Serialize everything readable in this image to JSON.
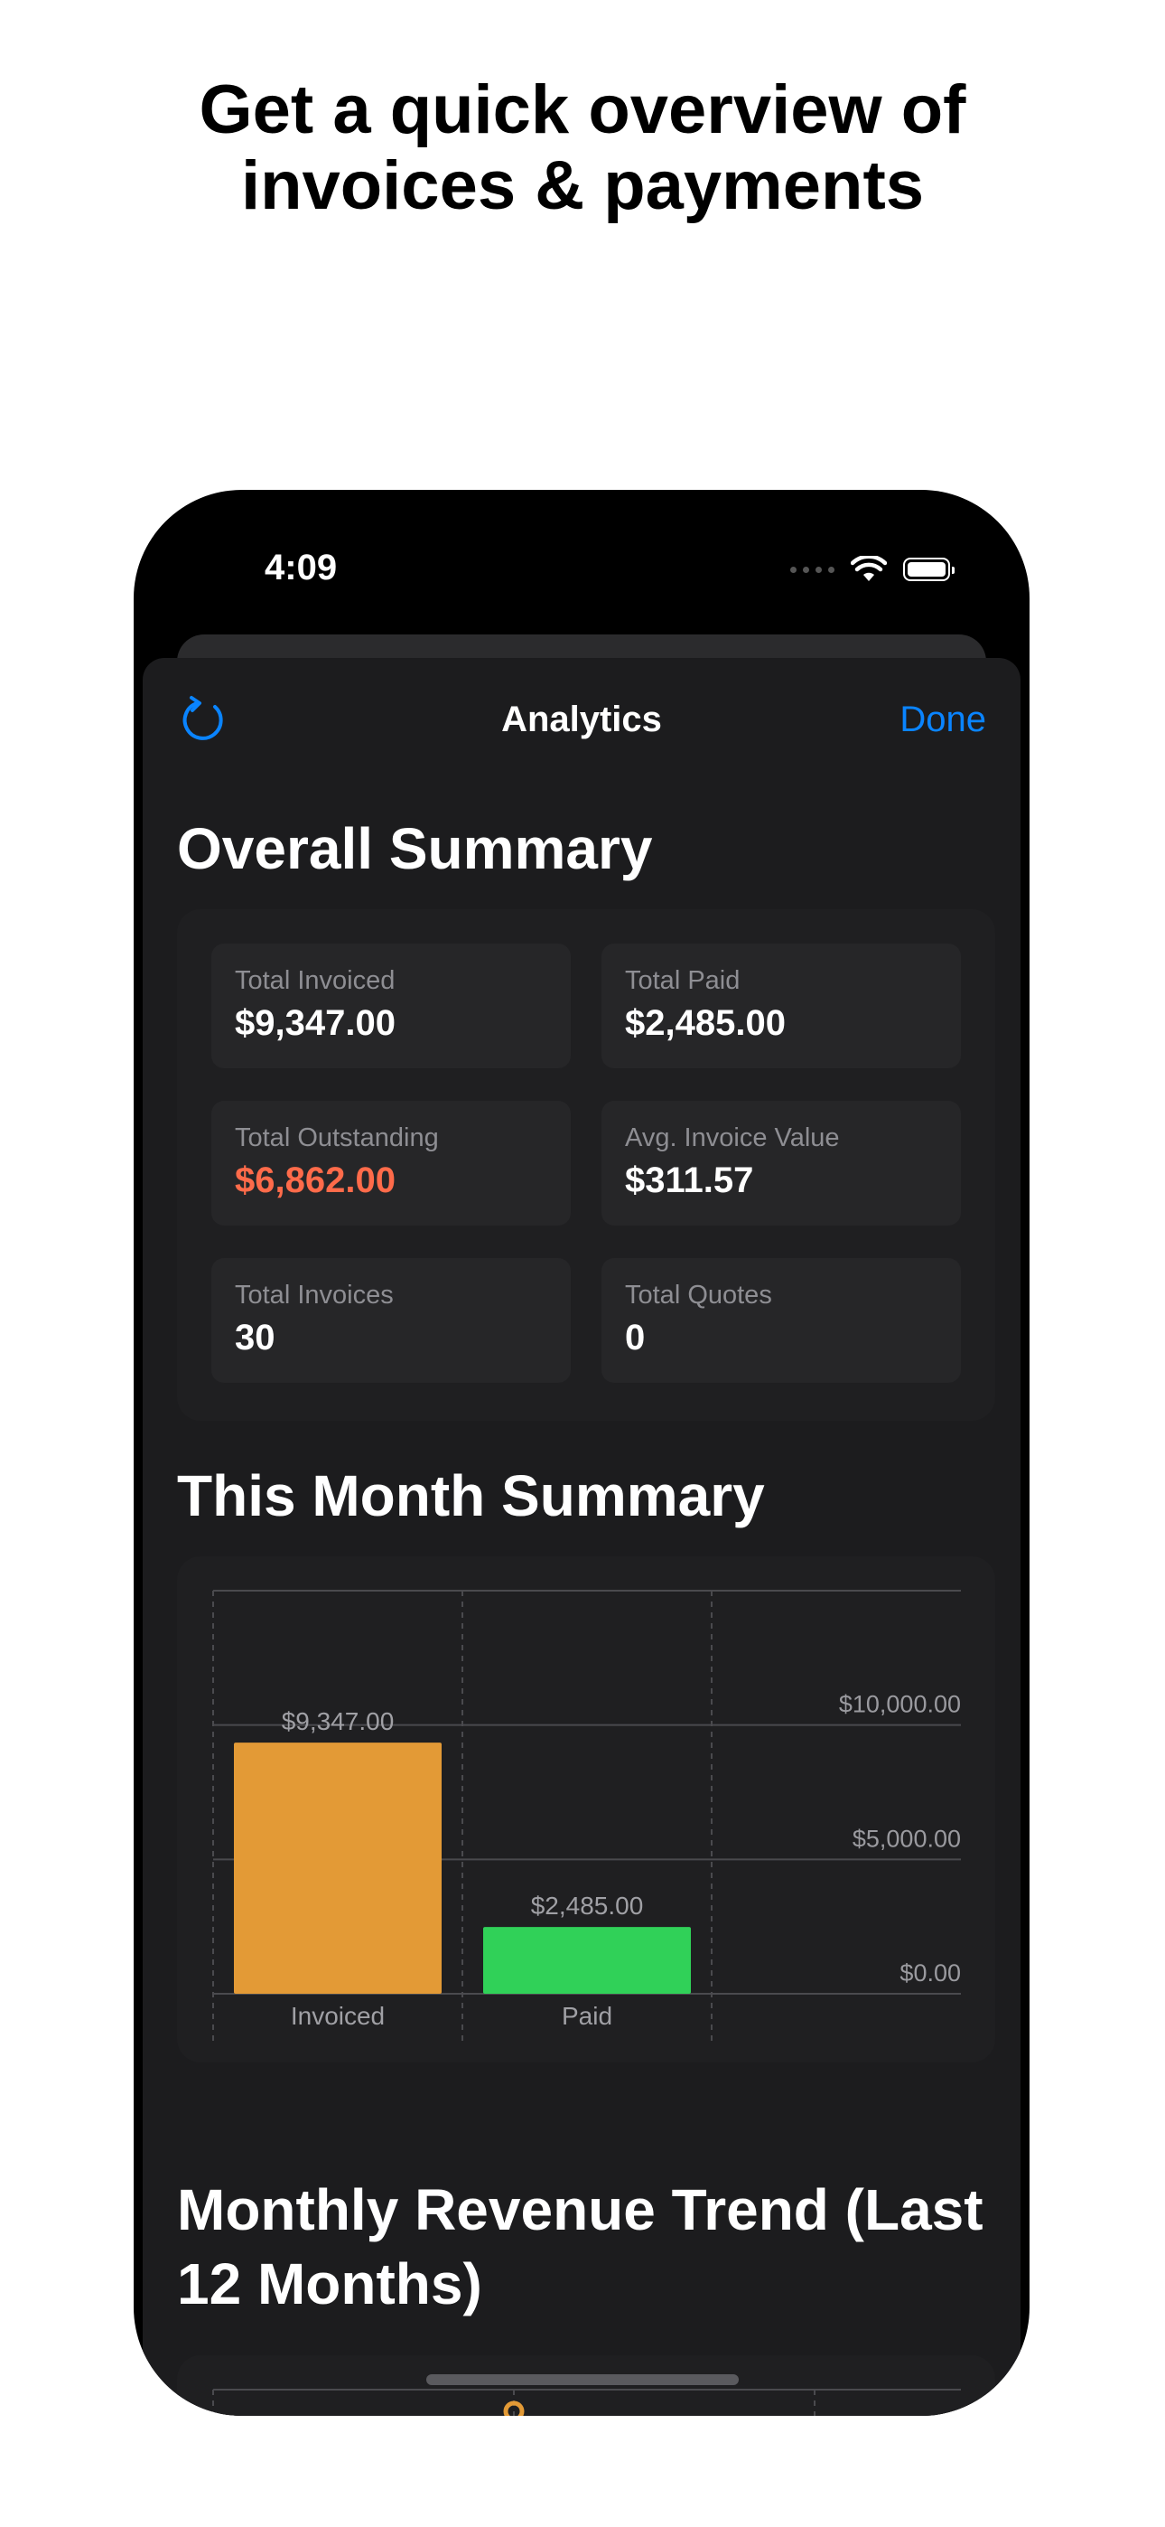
{
  "headline": {
    "line1": "Get a quick overview of",
    "line2": "invoices & payments"
  },
  "status_bar": {
    "time": "4:09"
  },
  "navbar": {
    "title": "Analytics",
    "done_label": "Done",
    "refresh_icon": "refresh-icon",
    "accent_color": "#0a84ff"
  },
  "overall_summary": {
    "title": "Overall Summary",
    "stats": [
      {
        "label": "Total Invoiced",
        "value": "$9,347.00"
      },
      {
        "label": "Total Paid",
        "value": "$2,485.00"
      },
      {
        "label": "Total Outstanding",
        "value": "$6,862.00"
      },
      {
        "label": "Avg. Invoice Value",
        "value": "$311.57"
      },
      {
        "label": "Total Invoices",
        "value": "30"
      },
      {
        "label": "Total Quotes",
        "value": "0"
      }
    ],
    "outstanding_color": "#ff6b4a"
  },
  "this_month": {
    "title": "This Month Summary",
    "chart_data": {
      "type": "bar",
      "categories": [
        "Invoiced",
        "Paid"
      ],
      "values": [
        9347,
        2485
      ],
      "value_labels": [
        "$9,347.00",
        "$2,485.00"
      ],
      "colors": [
        "#e39a36",
        "#30d158"
      ],
      "ylim": [
        0,
        15000
      ],
      "yticks": [
        0,
        5000,
        10000
      ],
      "ytick_labels": [
        "$0.00",
        "$5,000.00",
        "$10,000.00"
      ],
      "grid": true
    }
  },
  "revenue_trend": {
    "title_line1": "Monthly Revenue Trend (Last",
    "title_line2": "12 Months)",
    "line_color": "#e39a36"
  }
}
